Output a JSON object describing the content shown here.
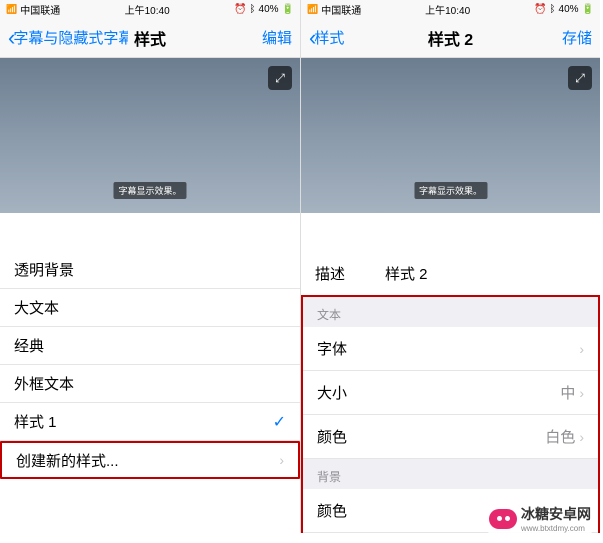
{
  "status": {
    "carrier": "中国联通",
    "time": "上午10:40",
    "battery": "40%"
  },
  "left": {
    "back": "字幕与隐藏式字幕",
    "title": "样式",
    "action": "编辑",
    "sample": "字幕显示效果。",
    "rows": [
      {
        "label": "透明背景"
      },
      {
        "label": "大文本"
      },
      {
        "label": "经典"
      },
      {
        "label": "外框文本"
      },
      {
        "label": "样式 1",
        "selected": true
      }
    ],
    "create": "创建新的样式..."
  },
  "right": {
    "back": "样式",
    "title": "样式 2",
    "action": "存储",
    "sample": "字幕显示效果。",
    "desc_label": "描述",
    "desc_value": "样式 2",
    "sections": {
      "text": {
        "header": "文本",
        "font": {
          "label": "字体"
        },
        "size": {
          "label": "大小",
          "value": "中"
        },
        "color": {
          "label": "颜色",
          "value": "白色"
        }
      },
      "bg": {
        "header": "背景",
        "color": {
          "label": "颜色"
        }
      }
    }
  },
  "watermark": "冰糖安卓网",
  "watermark_url": "www.btxtdmy.com"
}
